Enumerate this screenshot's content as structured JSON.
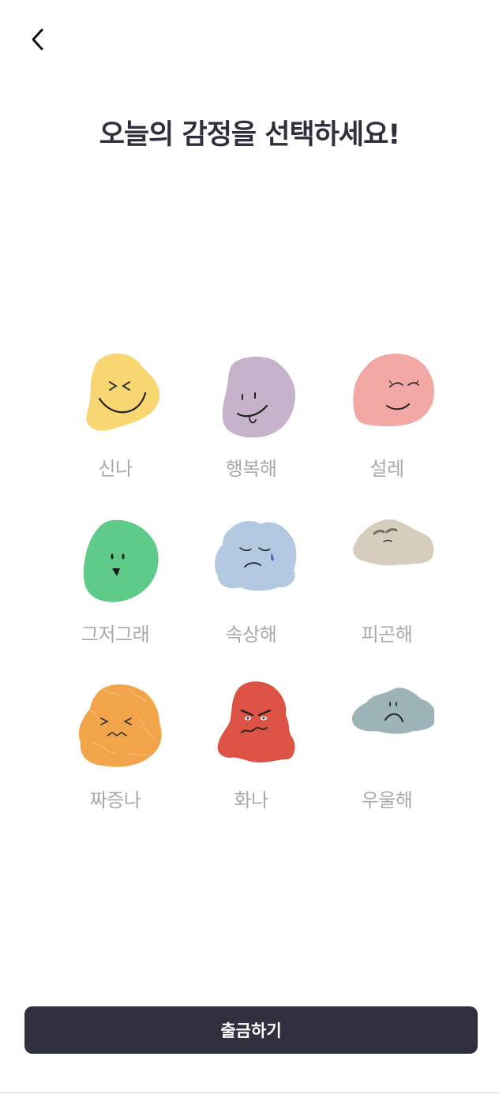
{
  "header": {
    "back_icon": "chevron-left-icon",
    "title": "오늘의 감정을 선택하세요!"
  },
  "emotions": [
    {
      "label": "신나",
      "color": "#f8d672",
      "face": "excited"
    },
    {
      "label": "행복해",
      "color": "#c7b2cc",
      "face": "happy"
    },
    {
      "label": "설레",
      "color": "#f2a8a5",
      "face": "fluttered"
    },
    {
      "label": "그저그래",
      "color": "#5fcb8a",
      "face": "meh"
    },
    {
      "label": "속상해",
      "color": "#b3c9e1",
      "face": "upset"
    },
    {
      "label": "피곤해",
      "color": "#d6cdbf",
      "face": "tired"
    },
    {
      "label": "짜증나",
      "color": "#f2a44b",
      "face": "annoyed"
    },
    {
      "label": "화나",
      "color": "#dc5244",
      "face": "angry"
    },
    {
      "label": "우울해",
      "color": "#9db5b8",
      "face": "depressed"
    }
  ],
  "footer": {
    "button_label": "출금하기"
  }
}
